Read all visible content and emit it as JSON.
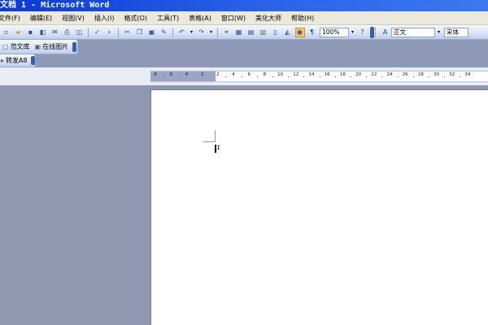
{
  "window": {
    "title": "文档 1 - Microsoft Word"
  },
  "menu": [
    "文件(F)",
    "编辑(E)",
    "视图(V)",
    "插入(I)",
    "格式(O)",
    "工具(T)",
    "表格(A)",
    "窗口(W)",
    "美化大师",
    "帮助(H)"
  ],
  "toolbar": {
    "zoom": "100%",
    "style": "正文",
    "font": "宋体"
  },
  "toolbar2": {
    "template_library": "范文库",
    "online_images": "在线图片"
  },
  "toolbar3": {
    "convert": "转发A8"
  },
  "ruler": {
    "ticks": [
      "8",
      "6",
      "4",
      "2",
      "2",
      "4",
      "6",
      "8",
      "10",
      "12",
      "14",
      "16",
      "18",
      "20",
      "22",
      "24",
      "26",
      "28",
      "30",
      "32",
      "34"
    ]
  }
}
